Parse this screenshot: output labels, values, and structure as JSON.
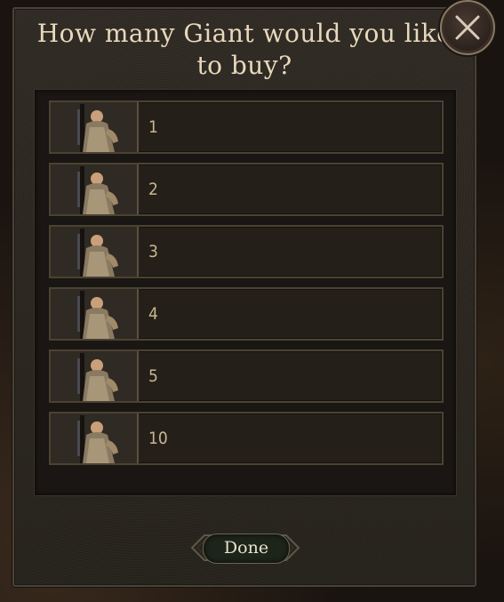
{
  "dialog": {
    "title_line1": "How many Giant would you like",
    "title_line2": "to buy?",
    "options": [
      {
        "label": "1"
      },
      {
        "label": "2"
      },
      {
        "label": "3"
      },
      {
        "label": "4"
      },
      {
        "label": "5"
      },
      {
        "label": "10"
      }
    ],
    "done_label": "Done",
    "close_icon": "close-icon",
    "unit_icon": "giant-unit-portrait-icon"
  },
  "colors": {
    "title": "#e8d9bd",
    "option_text": "#c9b791",
    "row_border": "#4b4232",
    "panel_bg": "#2b2620"
  }
}
